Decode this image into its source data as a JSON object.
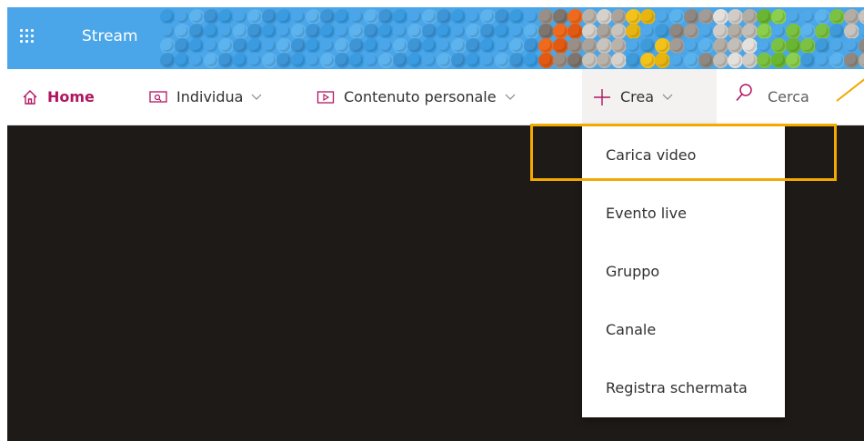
{
  "app": {
    "title": "Stream"
  },
  "nav": {
    "home": "Home",
    "discover": "Individua",
    "my_content": "Contenuto personale",
    "create": "Crea",
    "search": "Cerca"
  },
  "create_menu": {
    "items": [
      {
        "label": "Carica video"
      },
      {
        "label": "Evento live"
      },
      {
        "label": "Gruppo"
      },
      {
        "label": "Canale"
      },
      {
        "label": "Registra schermata"
      }
    ],
    "highlighted_index": 0
  },
  "colors": {
    "header_bg": "#4aa6e8",
    "brand_accent": "#b01560",
    "highlight": "#f2a900",
    "content_bg": "#1e1a17"
  },
  "icons": {
    "app_launcher": "waffle-icon",
    "home": "home-icon",
    "discover": "discover-icon",
    "my_content": "video-icon",
    "create": "plus-icon",
    "search": "search-icon",
    "chevron": "chevron-down-icon"
  }
}
